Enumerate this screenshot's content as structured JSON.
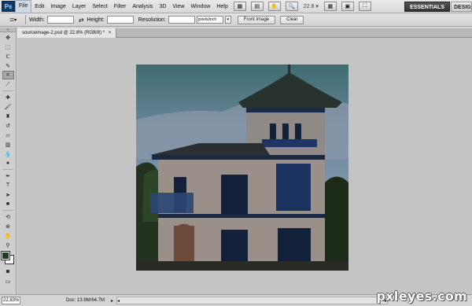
{
  "app": {
    "logo": "Ps"
  },
  "menu": {
    "items": [
      "File",
      "Edit",
      "Image",
      "Layer",
      "Select",
      "Filter",
      "Analysis",
      "3D",
      "View",
      "Window",
      "Help"
    ],
    "zoom_display": "22.8",
    "zoom_arrow": "▾",
    "workspace": "ESSENTIALS",
    "workspace2": "DESIGN"
  },
  "options": {
    "width_label": "Width:",
    "height_label": "Height:",
    "resolution_label": "Resolution:",
    "resolution_unit": "pixels/inch",
    "front_image_button": "Front Image",
    "clear_button": "Clear",
    "swap_glyph": "⇄"
  },
  "document": {
    "tab_title": "sourceimage-2.psd @ 22.8% (RGB/8) *",
    "close_glyph": "×"
  },
  "status": {
    "zoom": "22.83%",
    "doc_info": "Doc: 13.9M/64.7M",
    "arrow": "▸",
    "scroll_left": "◂",
    "scroll_right": "▸"
  },
  "watermark": "pxleyes.com",
  "icons": {
    "tool_move": "move-icon",
    "crop": "crop-icon"
  },
  "colors": {
    "foreground": "#1f3d25",
    "background": "#ffffff",
    "workspace_active": "#3a3a3a"
  }
}
